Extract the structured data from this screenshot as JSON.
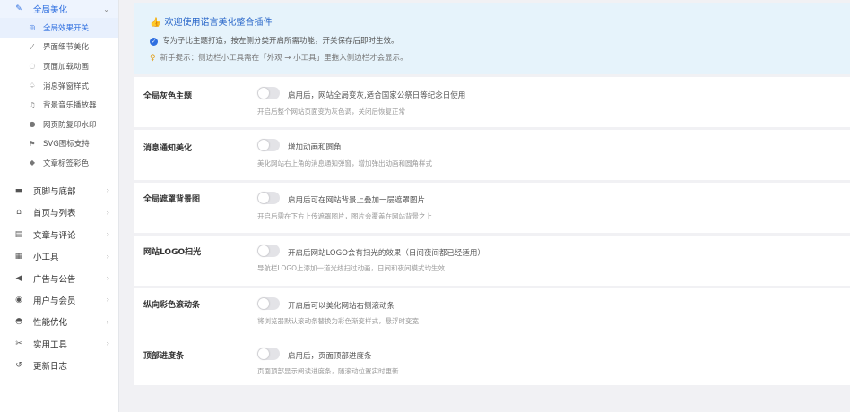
{
  "sidebar": {
    "top_group": {
      "label": "全局美化",
      "icon": "magic-wand-icon"
    },
    "sub_items": [
      {
        "label": "全局效果开关",
        "icon": "settings-circle-icon"
      },
      {
        "label": "界面细节美化",
        "icon": "brush-icon"
      },
      {
        "label": "页面加载动画",
        "icon": "spinner-icon"
      },
      {
        "label": "消息弹窗样式",
        "icon": "bell-icon"
      },
      {
        "label": "背景音乐播放器",
        "icon": "music-note-icon"
      },
      {
        "label": "网页防复印水印",
        "icon": "droplet-icon"
      },
      {
        "label": "SVG图标支持",
        "icon": "flag-icon"
      },
      {
        "label": "文章标签彩色",
        "icon": "tag-icon"
      }
    ],
    "groups": [
      {
        "label": "页脚与底部",
        "icon": "layout-icon"
      },
      {
        "label": "首页与列表",
        "icon": "home-icon"
      },
      {
        "label": "文章与评论",
        "icon": "document-icon"
      },
      {
        "label": "小工具",
        "icon": "grid-icon"
      },
      {
        "label": "广告与公告",
        "icon": "megaphone-icon"
      },
      {
        "label": "用户与会员",
        "icon": "user-icon"
      },
      {
        "label": "性能优化",
        "icon": "speedometer-icon"
      },
      {
        "label": "实用工具",
        "icon": "wrench-icon"
      },
      {
        "label": "更新日志",
        "icon": "history-icon"
      }
    ]
  },
  "notice": {
    "title": "欢迎使用诺言美化整合插件",
    "line1": "专为子比主题打造，按左侧分类开启所需功能，开关保存后即时生效。",
    "line2": "新手提示：侧边栏小工具需在「外观 → 小工具」里拖入侧边栏才会显示。"
  },
  "settings": [
    {
      "name": "全局灰色主题",
      "label": "启用后，网站全局变灰,适合国家公祭日等纪念日使用",
      "desc": "开启后整个网站页面变为灰色调，关闭后恢复正常",
      "enabled": false
    },
    {
      "name": "消息通知美化",
      "label": "增加动画和圆角",
      "desc": "美化网站右上角的消息通知弹窗，增加弹出动画和圆角样式",
      "enabled": false
    },
    {
      "name": "全局遮罩背景图",
      "label": "启用后可在网站背景上叠加一层遮罩图片",
      "desc": "开启后需在下方上传遮罩图片，图片会覆盖在网站背景之上",
      "enabled": false
    },
    {
      "name": "网站LOGO扫光",
      "label": "开启后网站LOGO会有扫光的效果（日间夜间都已经适用）",
      "desc": "导航栏LOGO上添加一道光线扫过动画，日间和夜间模式均生效",
      "enabled": false
    },
    {
      "name": "纵向彩色滚动条",
      "label": "开启后可以美化网站右侧滚动条",
      "desc": "将浏览器默认滚动条替换为彩色渐变样式，悬浮时变宽",
      "enabled": false
    },
    {
      "name": "顶部进度条",
      "label": "启用后，页面顶部进度条",
      "desc": "页面顶部显示阅读进度条，随滚动位置实时更新",
      "enabled": false
    }
  ],
  "colors": {
    "accent": "#2f6fe0",
    "notice_bg": "#e6f3fb",
    "page_bg": "#f1f1f4"
  }
}
